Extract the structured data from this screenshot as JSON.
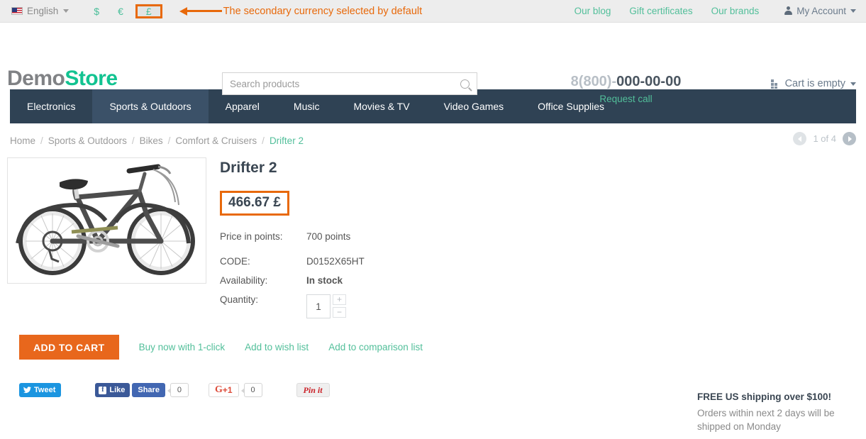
{
  "topbar": {
    "language": {
      "label": "English",
      "flag_icon": "us-flag-icon"
    },
    "currencies": [
      {
        "symbol": "$",
        "code": "USD",
        "active": false
      },
      {
        "symbol": "€",
        "code": "EUR",
        "active": false
      },
      {
        "symbol": "£",
        "code": "GBP",
        "active": true
      }
    ],
    "annotation": {
      "text": "The secondary currency selected by default",
      "color": "#e8690b",
      "arrow_icon": "left-arrow-annotation-icon"
    },
    "links": [
      {
        "label": "Our blog"
      },
      {
        "label": "Gift certificates"
      },
      {
        "label": "Our brands"
      }
    ],
    "account": {
      "label": "My Account",
      "icon": "person-icon"
    },
    "link_color": "#52bf9a"
  },
  "header": {
    "logo": {
      "first": "Demo",
      "second": "Store",
      "first_color": "#808285",
      "second_color": "#12c391"
    },
    "search": {
      "placeholder": "Search products",
      "value": "",
      "icon": "search-icon"
    },
    "phone": {
      "prefix": "8(800)-",
      "digits": "000-00-00",
      "request_call": "Request call"
    },
    "cart": {
      "label": "Cart is empty",
      "icon": "cart-grid-icon"
    }
  },
  "nav": {
    "items": [
      {
        "label": "Electronics",
        "active": false
      },
      {
        "label": "Sports & Outdoors",
        "active": true
      },
      {
        "label": "Apparel",
        "active": false
      },
      {
        "label": "Music",
        "active": false
      },
      {
        "label": "Movies & TV",
        "active": false
      },
      {
        "label": "Video Games",
        "active": false
      },
      {
        "label": "Office Supplies",
        "active": false
      }
    ],
    "bg_color": "#2f4254",
    "active_bg_color": "#3b5168"
  },
  "breadcrumb": {
    "items": [
      {
        "label": "Home"
      },
      {
        "label": "Sports & Outdoors"
      },
      {
        "label": "Bikes"
      },
      {
        "label": "Comfort & Cruisers"
      },
      {
        "label": "Drifter 2"
      }
    ],
    "separator": "/"
  },
  "pager": {
    "text": "1 of 4",
    "prev_icon": "chevron-left-icon",
    "next_icon": "chevron-right-icon",
    "prev_enabled": false,
    "next_enabled": true
  },
  "product": {
    "title": "Drifter 2",
    "image_alt": "gray cruiser bicycle",
    "price": "466.67 £",
    "price_highlight_color": "#e8690b",
    "specs": [
      {
        "label": "Price in points:",
        "value": "700 points"
      },
      {
        "label": "CODE:",
        "value": "D0152X65HT"
      },
      {
        "label": "Availability:",
        "value": "In stock"
      }
    ],
    "quantity": {
      "label": "Quantity:",
      "value": "1",
      "plus": "+",
      "minus": "−"
    },
    "add_to_cart": "ADD TO CART",
    "add_to_cart_color": "#e8671c",
    "action_links": [
      {
        "label": "Buy now with 1-click"
      },
      {
        "label": "Add to wish list"
      },
      {
        "label": "Add to comparison list"
      }
    ]
  },
  "social": {
    "tweet": {
      "label": "Tweet",
      "icon": "twitter-bird-icon"
    },
    "facebook_like": {
      "label": "Like",
      "icon": "facebook-f-icon"
    },
    "facebook_share": {
      "label": "Share",
      "count": "0"
    },
    "google_plus": {
      "label": "G",
      "suffix": "+1",
      "count": "0"
    },
    "pinterest": {
      "label": "Pin it"
    }
  },
  "shipping": {
    "title": "FREE US shipping over $100!",
    "text": "Orders within next 2 days will be shipped on Monday"
  }
}
